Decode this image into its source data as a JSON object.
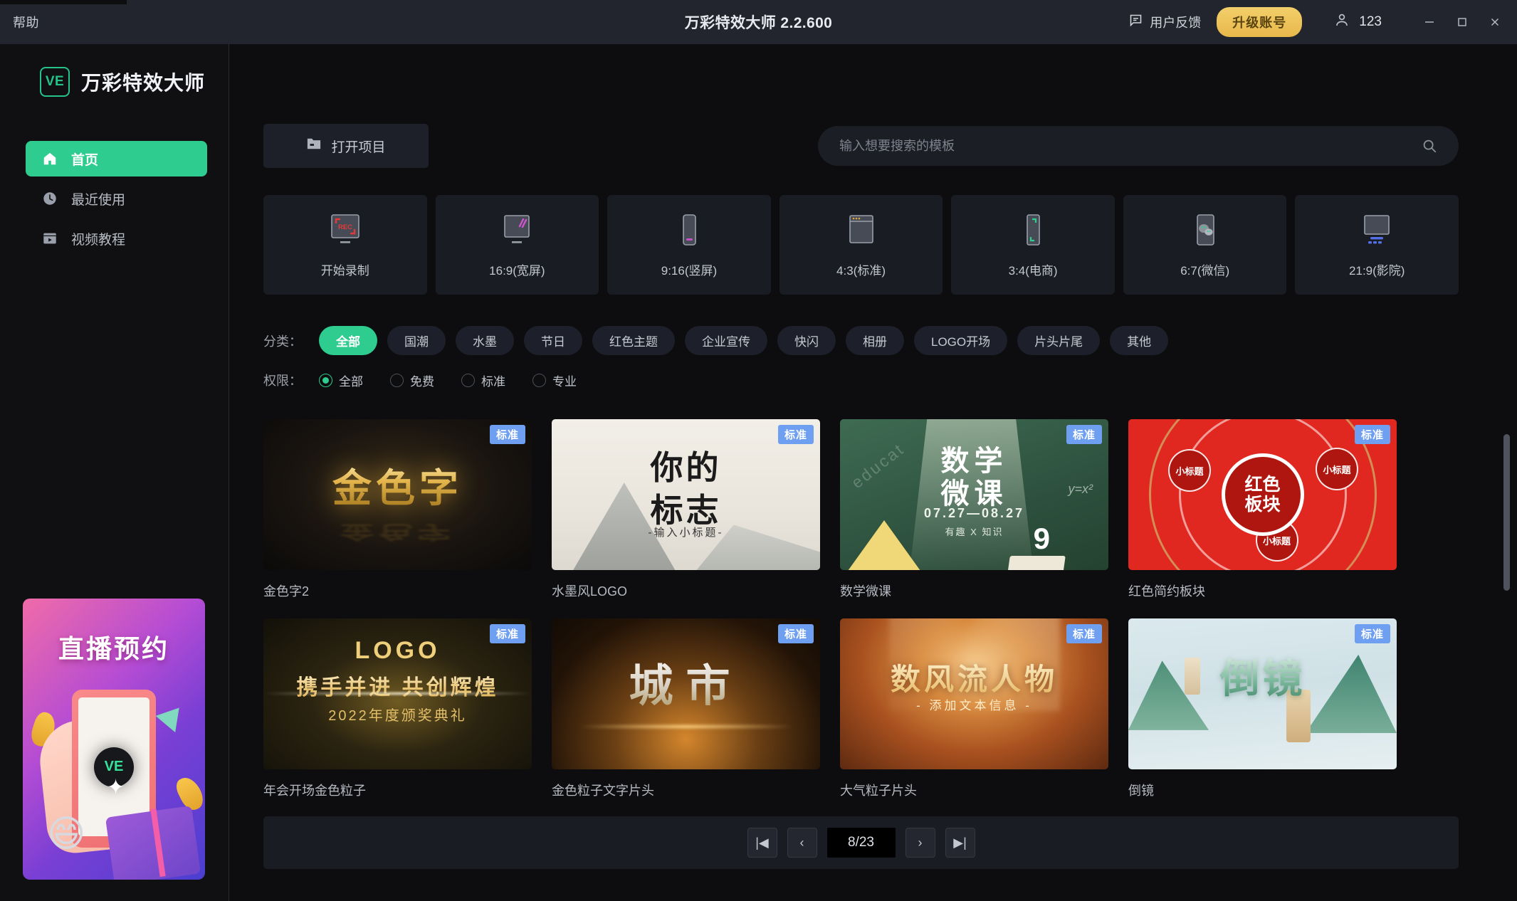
{
  "titlebar": {
    "help": "帮助",
    "app_title": "万彩特效大师 2.2.600",
    "feedback": "用户反馈",
    "upgrade": "升级账号",
    "username": "123",
    "minimize": "—",
    "maximize": "▢",
    "close": "✕"
  },
  "sidebar": {
    "logo_text": "VE",
    "brand": "万彩特效大师",
    "items": [
      {
        "label": "首页",
        "icon": "home-icon",
        "active": true
      },
      {
        "label": "最近使用",
        "icon": "clock-icon",
        "active": false
      },
      {
        "label": "视频教程",
        "icon": "video-tutorial-icon",
        "active": false
      }
    ],
    "promo": {
      "title": "直播预约",
      "logo": "VE"
    }
  },
  "toolbar": {
    "open_project": "打开项目",
    "search_placeholder": "输入想要搜索的模板",
    "search_value": ""
  },
  "ratio_cards": [
    {
      "label": "开始录制",
      "icon": "record-icon"
    },
    {
      "label": "16:9(宽屏)",
      "icon": "widescreen-icon"
    },
    {
      "label": "9:16(竖屏)",
      "icon": "portrait-icon"
    },
    {
      "label": "4:3(标准)",
      "icon": "standard-icon"
    },
    {
      "label": "3:4(电商)",
      "icon": "ecommerce-icon"
    },
    {
      "label": "6:7(微信)",
      "icon": "wechat-icon"
    },
    {
      "label": "21:9(影院)",
      "icon": "cinema-icon"
    }
  ],
  "filters": {
    "category_label": "分类：",
    "categories": [
      {
        "label": "全部",
        "selected": true
      },
      {
        "label": "国潮",
        "selected": false
      },
      {
        "label": "水墨",
        "selected": false
      },
      {
        "label": "节日",
        "selected": false
      },
      {
        "label": "红色主题",
        "selected": false
      },
      {
        "label": "企业宣传",
        "selected": false
      },
      {
        "label": "快闪",
        "selected": false
      },
      {
        "label": "相册",
        "selected": false
      },
      {
        "label": "LOGO开场",
        "selected": false
      },
      {
        "label": "片头片尾",
        "selected": false
      },
      {
        "label": "其他",
        "selected": false
      }
    ],
    "permission_label": "权限：",
    "permissions": [
      {
        "label": "全部",
        "selected": true
      },
      {
        "label": "免费",
        "selected": false
      },
      {
        "label": "标准",
        "selected": false
      },
      {
        "label": "专业",
        "selected": false
      }
    ]
  },
  "templates": [
    {
      "name": "金色字2",
      "badge": "标准",
      "art": {
        "l1": "金色字"
      }
    },
    {
      "name": "水墨风LOGO",
      "badge": "标准",
      "art": {
        "l1": "你的",
        "l2": "标志",
        "l3": "-输入小标题-"
      }
    },
    {
      "name": "数学微课",
      "badge": "标准",
      "art": {
        "l1": "数学",
        "l2": "微课",
        "l3": "07.27—08.27",
        "l4": "有趣 X 知识",
        "num": "9",
        "edu": "educat",
        "yx": "y=x²"
      }
    },
    {
      "name": "红色简约板块",
      "badge": "标准",
      "art": {
        "l1": "红色",
        "l2": "板块",
        "b1": "小标题",
        "b2": "小标题",
        "b3": "小标题"
      }
    },
    {
      "name": "年会开场金色粒子",
      "badge": "标准",
      "art": {
        "l0": "LOGO",
        "l1": "携手并进  共创辉煌",
        "l2": "2022年度颁奖典礼"
      }
    },
    {
      "name": "金色粒子文字片头",
      "badge": "标准",
      "art": {
        "l1": "城市"
      }
    },
    {
      "name": "大气粒子片头",
      "badge": "标准",
      "art": {
        "l1": "数风流人物",
        "l2": "- 添加文本信息 -"
      }
    },
    {
      "name": "倒镜",
      "badge": "标准",
      "art": {
        "l1": "倒镜"
      }
    }
  ],
  "pagination": {
    "first": "|◀",
    "prev": "‹",
    "page": "8/23",
    "next": "›",
    "last": "▶|"
  }
}
